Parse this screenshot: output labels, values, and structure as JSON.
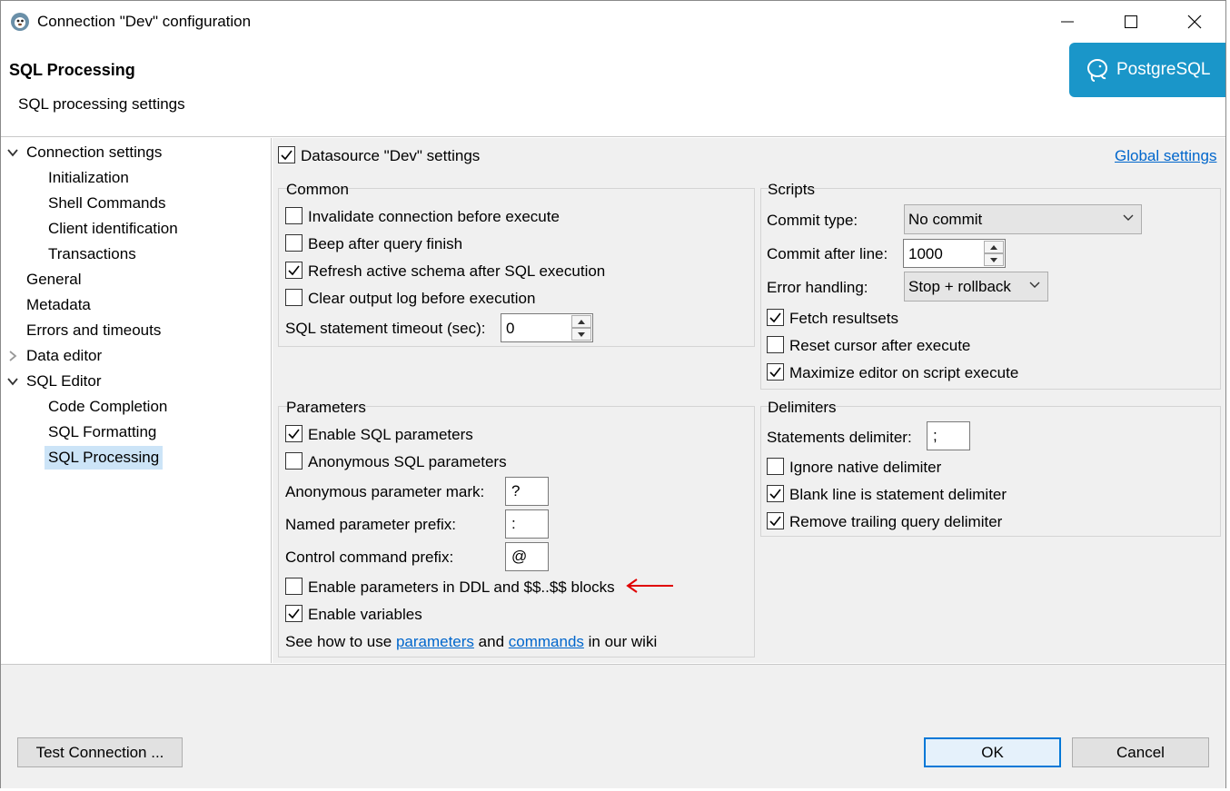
{
  "window": {
    "title": "Connection \"Dev\" configuration"
  },
  "header": {
    "title": "SQL Processing",
    "subtitle": "SQL processing settings",
    "logo_text": "PostgreSQL",
    "logo_color": "#1a96c9"
  },
  "tree": {
    "items": [
      {
        "label": "Connection settings",
        "expanded": true
      },
      {
        "label": "Initialization"
      },
      {
        "label": "Shell Commands"
      },
      {
        "label": "Client identification"
      },
      {
        "label": "Transactions"
      },
      {
        "label": "General"
      },
      {
        "label": "Metadata"
      },
      {
        "label": "Errors and timeouts"
      },
      {
        "label": "Data editor",
        "expanded": false
      },
      {
        "label": "SQL Editor",
        "expanded": true
      },
      {
        "label": "Code Completion"
      },
      {
        "label": "SQL Formatting"
      },
      {
        "label": "SQL Processing",
        "selected": true
      }
    ]
  },
  "datasource": {
    "label": "Datasource \"Dev\" settings",
    "checked": true,
    "global_link": "Global settings"
  },
  "common": {
    "title": "Common",
    "invalidate": {
      "label": "Invalidate connection before execute",
      "checked": false
    },
    "beep": {
      "label": "Beep after query finish",
      "checked": false
    },
    "refresh": {
      "label": "Refresh active schema after SQL execution",
      "checked": true
    },
    "clear_log": {
      "label": "Clear output log before execution",
      "checked": false
    },
    "timeout_label": "SQL statement timeout (sec):",
    "timeout_value": "0"
  },
  "scripts": {
    "title": "Scripts",
    "commit_type_label": "Commit type:",
    "commit_type_value": "No commit",
    "commit_after_label": "Commit after line:",
    "commit_after_value": "1000",
    "error_handling_label": "Error handling:",
    "error_handling_value": "Stop + rollback",
    "fetch": {
      "label": "Fetch resultsets",
      "checked": true
    },
    "reset_cursor": {
      "label": "Reset cursor after execute",
      "checked": false
    },
    "maximize": {
      "label": "Maximize editor on script execute",
      "checked": true
    }
  },
  "parameters": {
    "title": "Parameters",
    "enable_sql": {
      "label": "Enable SQL parameters",
      "checked": true
    },
    "anonymous": {
      "label": "Anonymous SQL parameters",
      "checked": false
    },
    "anon_mark_label": "Anonymous parameter mark:",
    "anon_mark_value": "?",
    "named_prefix_label": "Named parameter prefix:",
    "named_prefix_value": ":",
    "control_prefix_label": "Control command prefix:",
    "control_prefix_value": "@",
    "ddl": {
      "label": "Enable parameters in DDL and $$..$$ blocks",
      "checked": false
    },
    "variables": {
      "label": "Enable variables",
      "checked": true
    },
    "wiki_prefix": "See how to use",
    "wiki_link1": "parameters",
    "wiki_and": "and",
    "wiki_link2": "commands",
    "wiki_suffix": "in our wiki"
  },
  "delimiters": {
    "title": "Delimiters",
    "statements_label": "Statements delimiter:",
    "statements_value": ";",
    "ignore_native": {
      "label": "Ignore native delimiter",
      "checked": false
    },
    "blank_line": {
      "label": "Blank line is statement delimiter",
      "checked": true
    },
    "remove_trailing": {
      "label": "Remove trailing query delimiter",
      "checked": true
    }
  },
  "footer": {
    "test_label": "Test Connection ...",
    "ok_label": "OK",
    "cancel_label": "Cancel"
  },
  "annotation_color": "#e00000"
}
